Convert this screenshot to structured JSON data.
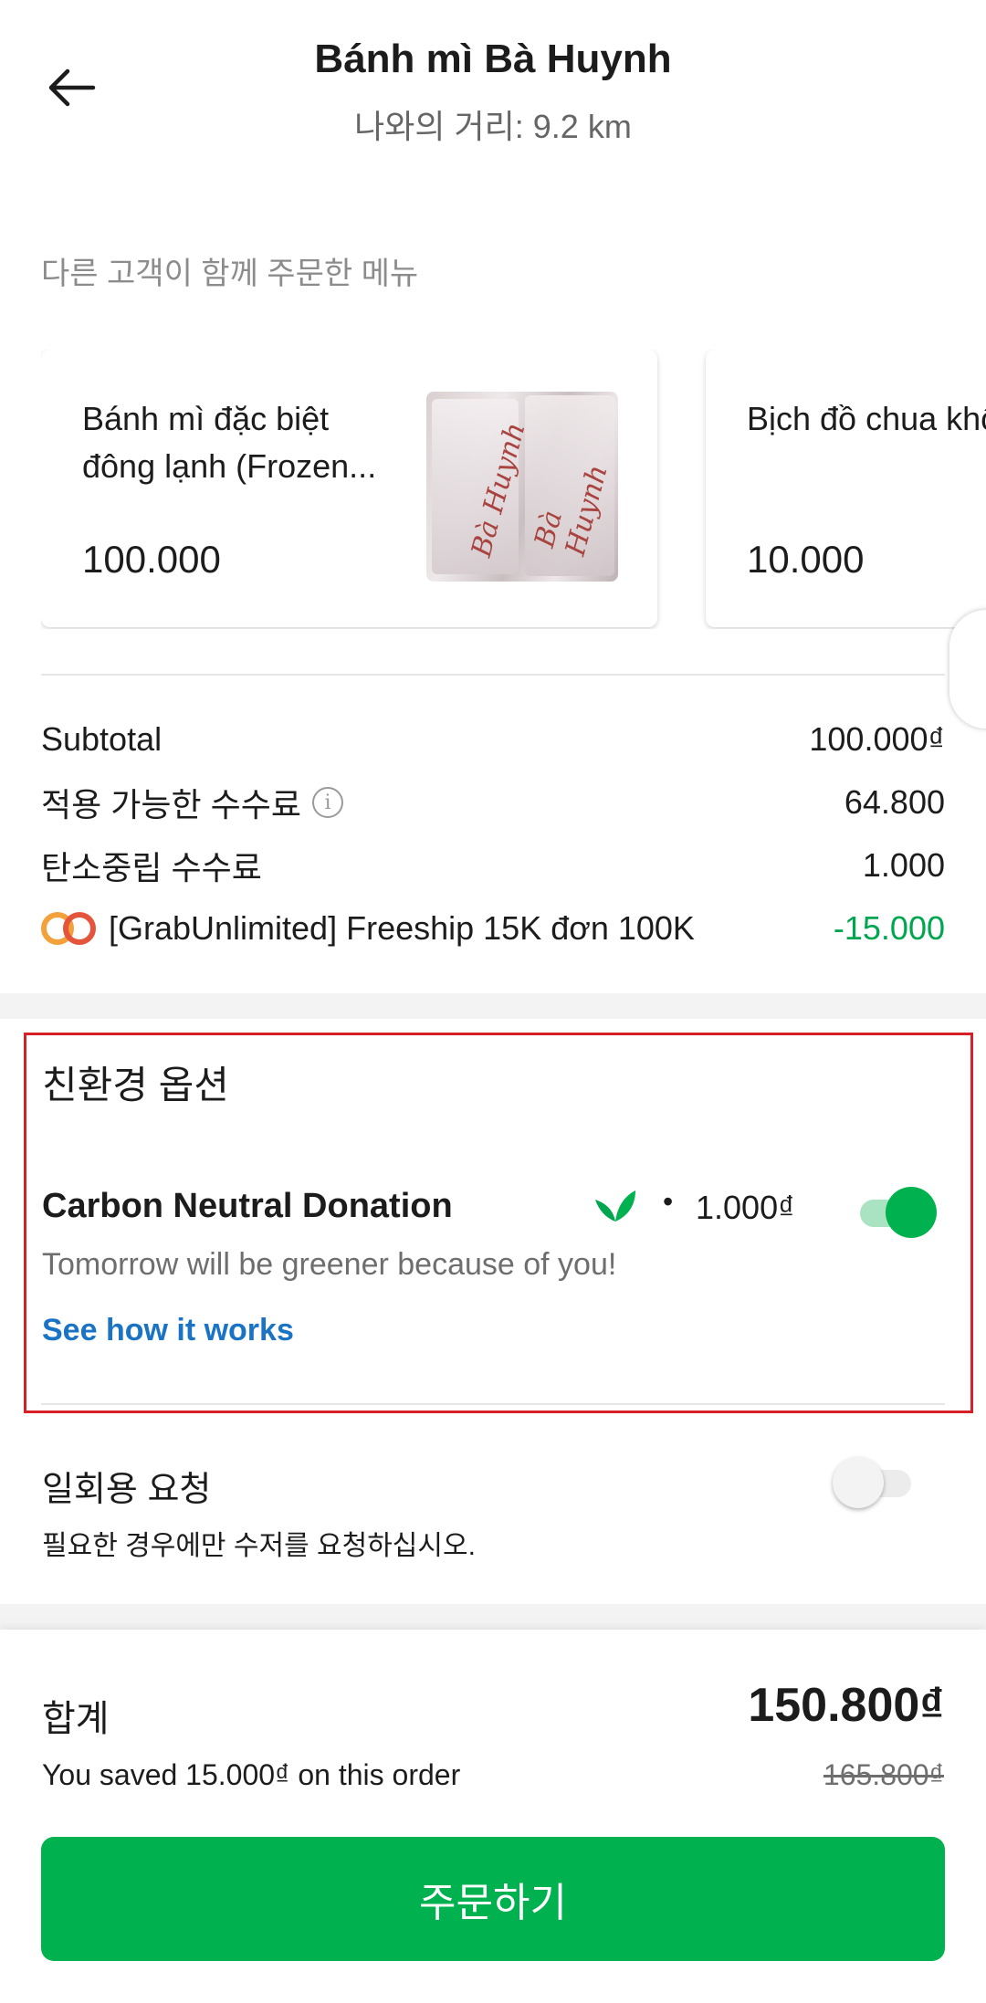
{
  "header": {
    "title": "Bánh mì Bà Huynh",
    "subtitle": "나와의 거리: 9.2 km"
  },
  "suggestions": {
    "label": "다른 고객이 함께 주문한 메뉴",
    "items": [
      {
        "name": "Bánh mì đặc biệt đông lạnh (Frozen...",
        "price": "100.000",
        "image_text": "Bà Huynh"
      },
      {
        "name": "Bịch đồ chua không...",
        "price": "10.000"
      }
    ]
  },
  "fees": {
    "subtotal_label": "Subtotal",
    "subtotal_value": "100.000₫",
    "service_fee_label": "적용 가능한 수수료",
    "service_fee_value": "64.800",
    "carbon_fee_label": "탄소중립 수수료",
    "carbon_fee_value": "1.000",
    "promo_label": "[GrabUnlimited] Freeship 15K đơn 100K",
    "promo_value": "-15.000"
  },
  "eco": {
    "title": "친환경 옵션",
    "carbon_title": "Carbon Neutral Donation",
    "carbon_bullet": "•",
    "carbon_price": "1.000₫",
    "carbon_desc": "Tomorrow will be greener because of you!",
    "carbon_link": "See how it works",
    "carbon_enabled": true
  },
  "utensils": {
    "title": "일회용 요청",
    "desc": "필요한 경우에만 수저를 요청하십시오.",
    "enabled": false
  },
  "footer": {
    "total_label": "합계",
    "total_value": "150.800₫",
    "saved_text": "You saved 15.000₫ on this order",
    "original_price": "165.800₫",
    "order_button": "주문하기"
  },
  "colors": {
    "brand_green": "#00b14f",
    "link_blue": "#1a73c5",
    "highlight_red": "#d61f26"
  },
  "icons": {
    "back": "arrow-left-icon",
    "info": "info-icon",
    "promo": "grab-unlimited-icon",
    "leaf": "leaf-icon"
  }
}
